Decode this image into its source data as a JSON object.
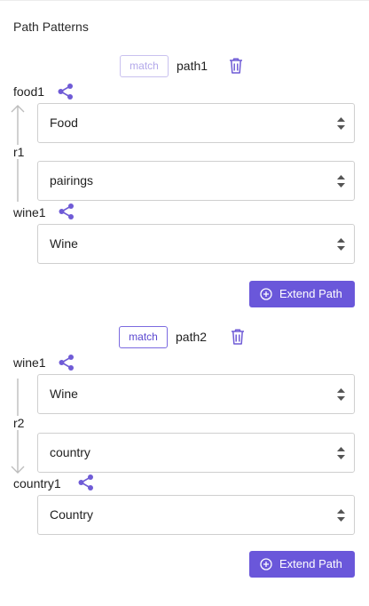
{
  "panel": {
    "title": "Path Patterns"
  },
  "patterns": [
    {
      "match_label": "match",
      "path_name": "path1",
      "source_node": {
        "label": "food1",
        "type": "Food"
      },
      "relation": {
        "label": "r1",
        "type": "pairings",
        "direction": "up"
      },
      "target_node": {
        "label": "wine1",
        "type": "Wine"
      },
      "extend_label": "Extend Path"
    },
    {
      "match_label": "match",
      "path_name": "path2",
      "source_node": {
        "label": "wine1",
        "type": "Wine"
      },
      "relation": {
        "label": "r2",
        "type": "country",
        "direction": "down"
      },
      "target_node": {
        "label": "country1",
        "type": "Country"
      },
      "extend_label": "Extend Path"
    }
  ],
  "colors": {
    "accent": "#6a57da",
    "icon": "#6f5bd6",
    "border": "#cfcfcf",
    "arrow": "#bdbdbd"
  }
}
